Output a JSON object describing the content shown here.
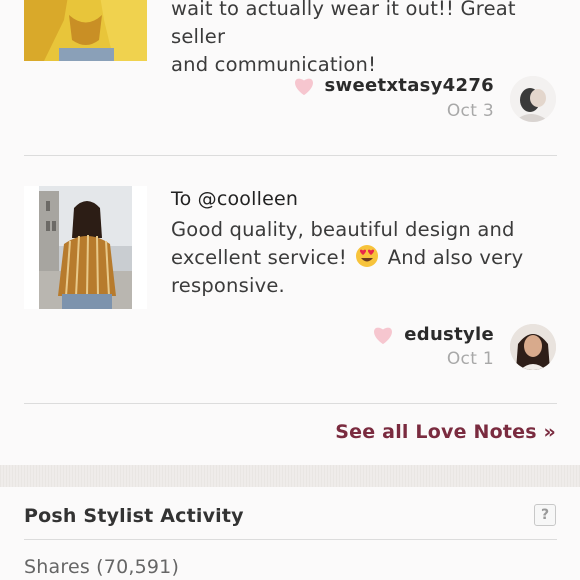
{
  "notes": [
    {
      "to": "",
      "text_lines": [
        "wait to actually wear it out!! Great seller",
        "and communication!"
      ],
      "author": "sweetxtasy4276",
      "date": "Oct 3",
      "product_image": "yellow-top-photo",
      "avatar_image": "user-avatar-photo"
    },
    {
      "to": "To @coolleen",
      "text_lines": [
        "Good quality, beautiful design and",
        "excellent service!",
        "And also very",
        "responsive."
      ],
      "emoji": "heart-eyes-emoji",
      "author": "edustyle",
      "date": "Oct 1",
      "product_image": "striped-blouse-photo",
      "avatar_image": "user-avatar-photo"
    }
  ],
  "see_all_label": "See all Love Notes »",
  "section": {
    "title": "Posh Stylist Activity",
    "help_label": "?",
    "shares_label": "Shares (70,591)"
  },
  "colors": {
    "accent": "#7a2b3f",
    "heart": "#f6c6cf",
    "background": "#fbfafa"
  }
}
